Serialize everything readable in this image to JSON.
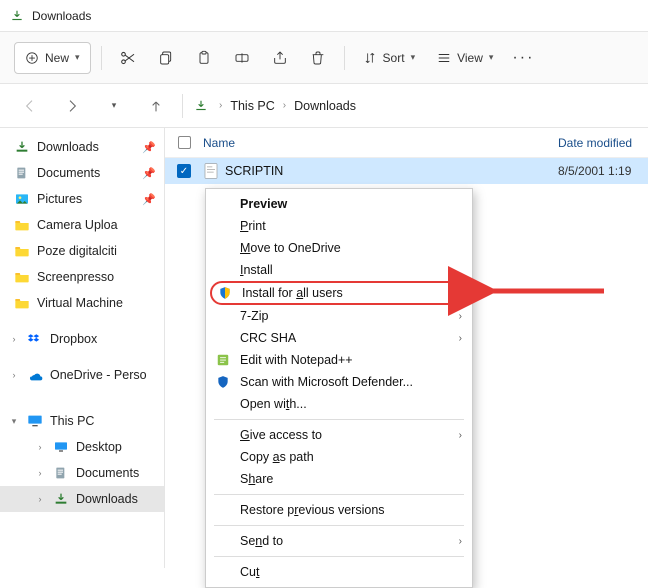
{
  "window": {
    "title": "Downloads"
  },
  "toolbar": {
    "new_label": "New",
    "sort_label": "Sort",
    "view_label": "View"
  },
  "breadcrumb": {
    "parts": [
      "This PC",
      "Downloads"
    ]
  },
  "sidebar": {
    "quick": [
      {
        "label": "Downloads",
        "icon": "download",
        "pinned": true
      },
      {
        "label": "Documents",
        "icon": "documents",
        "pinned": true
      },
      {
        "label": "Pictures",
        "icon": "pictures",
        "pinned": true
      },
      {
        "label": "Camera Uploa",
        "icon": "folder",
        "pinned": false
      },
      {
        "label": "Poze digitalciti",
        "icon": "folder",
        "pinned": false
      },
      {
        "label": "Screenpresso",
        "icon": "folder",
        "pinned": false
      },
      {
        "label": "Virtual Machine",
        "icon": "folder",
        "pinned": false
      }
    ],
    "roots": [
      {
        "label": "Dropbox",
        "icon": "dropbox",
        "exp": ">"
      },
      {
        "label": "OneDrive - Perso",
        "icon": "onedrive",
        "exp": ">"
      }
    ],
    "thispc": {
      "label": "This PC",
      "children": [
        {
          "label": "Desktop",
          "icon": "desktop",
          "exp": ">"
        },
        {
          "label": "Documents",
          "icon": "documents",
          "exp": ">"
        },
        {
          "label": "Downloads",
          "icon": "download",
          "exp": ">",
          "selected": true
        }
      ]
    }
  },
  "columns": {
    "name": "Name",
    "date": "Date modified"
  },
  "file": {
    "name": "SCRIPTIN",
    "date": "8/5/2001 1:19"
  },
  "context_menu": {
    "items": [
      {
        "label": "Preview",
        "bold": true,
        "acc": ""
      },
      {
        "label": "Print",
        "underline_idx": 0
      },
      {
        "label": "Move to OneDrive",
        "underline_idx": 0
      },
      {
        "label": "Install",
        "underline_idx": 0
      },
      {
        "label": "Install for all users",
        "icon": "shield",
        "highlight": true,
        "underline_idx": 12
      },
      {
        "label": "7-Zip",
        "submenu": true
      },
      {
        "label": "CRC SHA",
        "submenu": true
      },
      {
        "label": "Edit with Notepad++",
        "icon": "notepad"
      },
      {
        "label": "Scan with Microsoft Defender...",
        "icon": "defender"
      },
      {
        "label": "Open with...",
        "underline_idx": 7
      },
      {
        "sep": true
      },
      {
        "label": "Give access to",
        "submenu": true,
        "underline_idx": 0
      },
      {
        "label": "Copy as path",
        "underline_idx": 5
      },
      {
        "label": "Share",
        "underline_idx": 1
      },
      {
        "sep": true
      },
      {
        "label": "Restore previous versions",
        "underline_idx": 9
      },
      {
        "sep": true
      },
      {
        "label": "Send to",
        "submenu": true,
        "underline_idx": 2
      },
      {
        "sep": true
      },
      {
        "label": "Cut",
        "underline_idx": 2
      }
    ]
  }
}
